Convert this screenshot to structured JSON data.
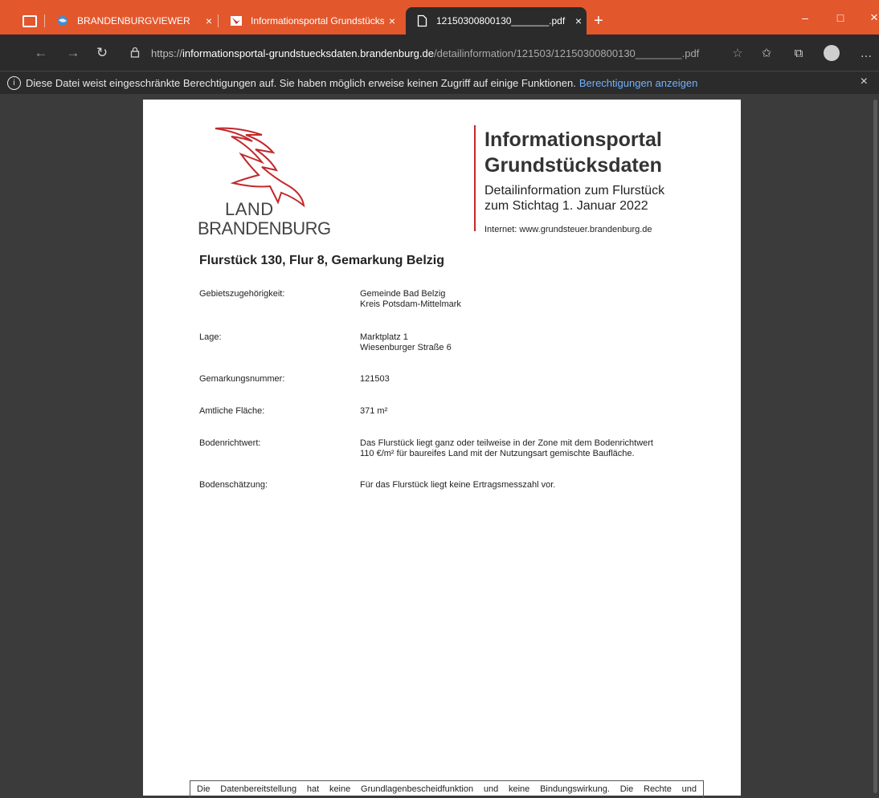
{
  "browser": {
    "tabs": [
      {
        "label": "BRANDENBURGVIEWER",
        "close": "×"
      },
      {
        "label": "Informationsportal Grundstücks",
        "close": "×"
      },
      {
        "label": "12150300800130_______.pdf",
        "close": "×"
      }
    ],
    "new_tab": "+",
    "window_controls": {
      "minimize": "–",
      "maximize": "□",
      "close": "×"
    },
    "url": {
      "scheme": "https://",
      "host": "informationsportal-grundstuecksdaten.brandenburg.de",
      "path": "/detailinformation/121503/12150300800130________.pdf"
    },
    "infobar": {
      "icon": "i",
      "text": "Diese Datei weist eingeschränkte Berechtigungen auf. Sie haben möglich erweise keinen Zugriff auf einige Funktionen.",
      "link": "Berechtigungen anzeigen",
      "close": "×"
    },
    "colors": {
      "accent": "#e3572c",
      "toolbar": "#2b2b2b",
      "link": "#71b1ff"
    }
  },
  "document": {
    "logo": {
      "line1": "LAND",
      "line2": "BRANDENBURG"
    },
    "header": {
      "title_line1": "Informationsportal",
      "title_line2": "Grundstücksdaten",
      "sub_line1": "Detailinformation zum Flurstück",
      "sub_line2": "zum Stichtag 1. Januar 2022",
      "internet": "Internet: www.grundsteuer.brandenburg.de"
    },
    "parcel_title": "Flurstück 130, Flur 8, Gemarkung Belzig",
    "fields": [
      {
        "label": "Gebietszugehörigkeit:",
        "lines": [
          "Gemeinde Bad Belzig",
          "Kreis Potsdam-Mittelmark"
        ]
      },
      {
        "label": "Lage:",
        "lines": [
          "Marktplatz 1",
          "Wiesenburger Straße 6"
        ]
      },
      {
        "label": "Gemarkungsnummer:",
        "lines": [
          "121503"
        ]
      },
      {
        "label": "Amtliche Fläche:",
        "lines": [
          "371 m²"
        ]
      },
      {
        "label": "Bodenrichtwert:",
        "lines": [
          "Das Flurstück liegt ganz oder teilweise in der Zone mit dem Bodenrichtwert",
          "110 €/m² für baureifes Land mit der Nutzungsart gemischte Baufläche."
        ]
      },
      {
        "label": "Bodenschätzung:",
        "lines": [
          "Für das Flurstück liegt keine Ertragsmesszahl vor."
        ]
      }
    ],
    "disclaimer": "Die Datenbereitstellung hat keine Grundlagenbescheidfunktion und keine Bindungswirkung. Die Rechte und"
  }
}
